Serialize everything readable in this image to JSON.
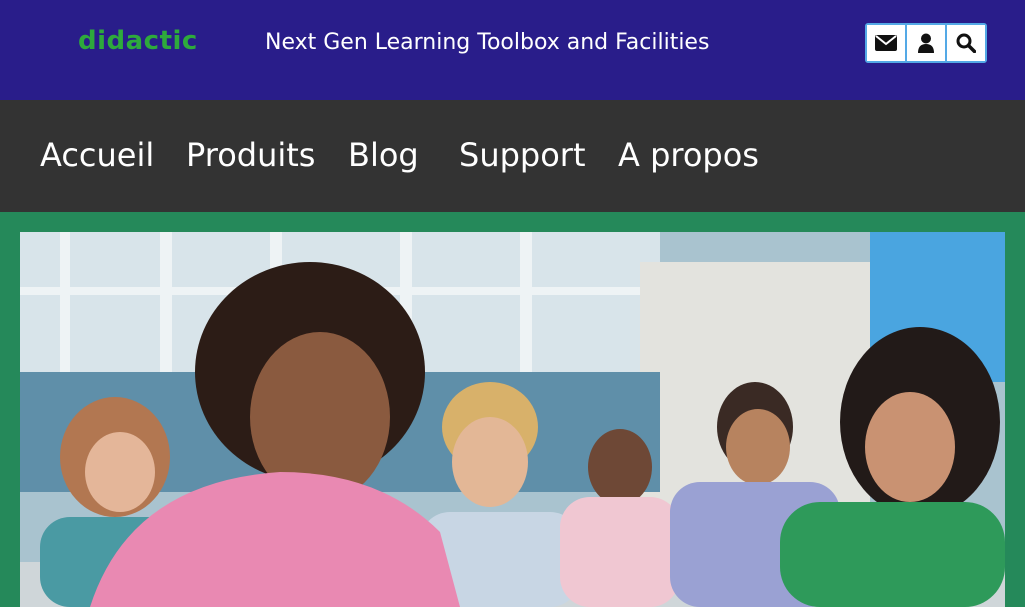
{
  "header": {
    "logo_text": "didactic",
    "tagline": "Next Gen Learning Toolbox and Facilities",
    "icons": [
      "envelope-icon",
      "user-icon",
      "search-icon"
    ]
  },
  "nav": {
    "items": [
      "Accueil",
      "Produits",
      "Blog",
      "Support",
      "A propos"
    ]
  },
  "colors": {
    "topbar": "#291d8a",
    "navbar": "#333333",
    "page_background": "#25895a",
    "logo": "#2eaa3c",
    "icon_group_border": "#54a9e6"
  },
  "hero": {
    "image": "classroom-students-writing-photo"
  }
}
